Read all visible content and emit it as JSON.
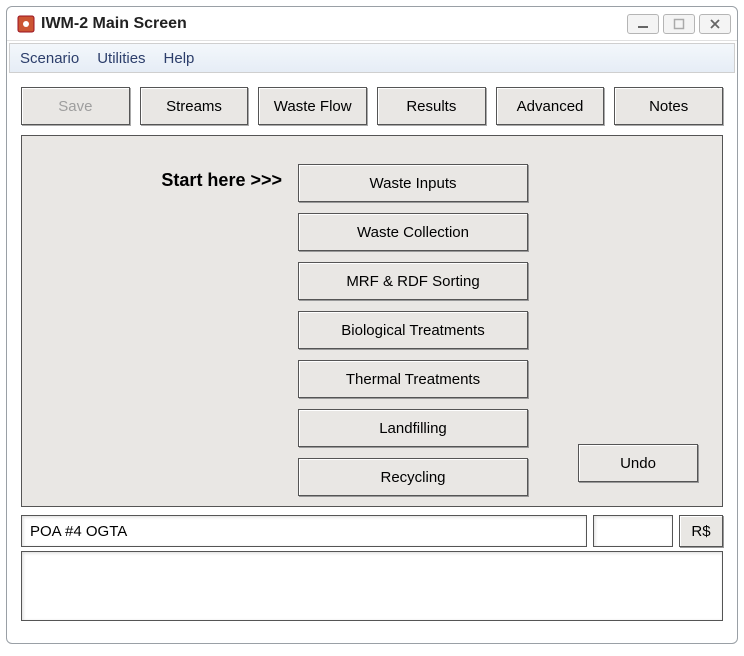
{
  "window": {
    "title": "IWM-2 Main Screen"
  },
  "menubar": {
    "scenario": "Scenario",
    "utilities": "Utilities",
    "help": "Help"
  },
  "toolbar": {
    "save": "Save",
    "streams": "Streams",
    "waste_flow": "Waste Flow",
    "results": "Results",
    "advanced": "Advanced",
    "notes": "Notes"
  },
  "panel": {
    "start_here": "Start here >>>",
    "buttons": {
      "waste_inputs": "Waste Inputs",
      "waste_collection": "Waste Collection",
      "mrf_rdf": "MRF & RDF Sorting",
      "biological": "Biological Treatments",
      "thermal": "Thermal Treatments",
      "landfilling": "Landfilling",
      "recycling": "Recycling"
    },
    "undo": "Undo"
  },
  "status": {
    "name": "POA #4 OGTA",
    "secondary": "",
    "currency": "R$"
  },
  "log": ""
}
